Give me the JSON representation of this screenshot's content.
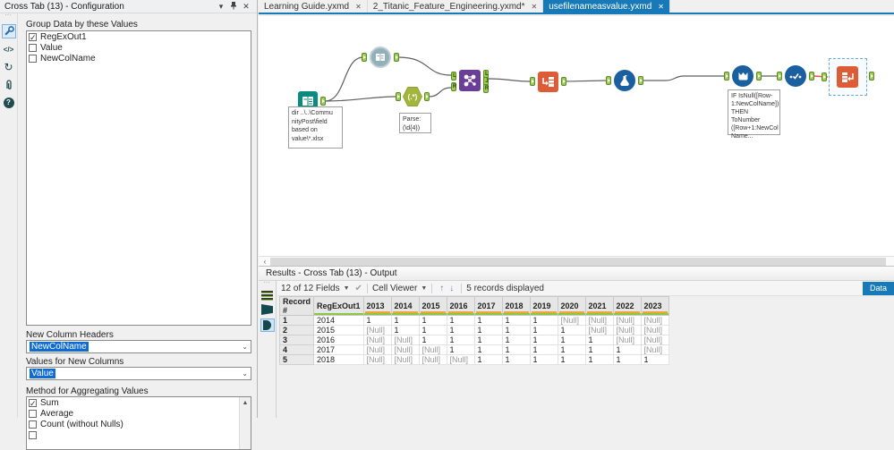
{
  "config_panel": {
    "title": "Cross Tab (13) - Configuration",
    "group_section_label": "Group Data by these Values",
    "group_items": [
      {
        "label": "RegExOut1",
        "checked": true
      },
      {
        "label": "Value",
        "checked": false
      },
      {
        "label": "NewColName",
        "checked": false
      }
    ],
    "new_column_headers": {
      "label": "New Column Headers",
      "value": "NewColName"
    },
    "values_for_new_columns": {
      "label": "Values for New Columns",
      "value": "Value"
    },
    "aggregation": {
      "label": "Method for Aggregating Values",
      "items": [
        {
          "label": "Sum",
          "checked": true
        },
        {
          "label": "Average",
          "checked": false
        },
        {
          "label": "Count (without Nulls)",
          "checked": false
        },
        {
          "label": "",
          "checked": false,
          "partial": true
        }
      ]
    }
  },
  "document_tabs": [
    {
      "label": "Learning Guide.yxmd",
      "active": false
    },
    {
      "label": "2_Titanic_Feature_Engineering.yxmd*",
      "active": false
    },
    {
      "label": "usefilenameasvalue.yxmd",
      "active": true
    }
  ],
  "canvas": {
    "tools": [
      {
        "name": "directory",
        "annotation": "dir ..\\..\\Commu\nnityPost\\field\nbased on\nvalue\\*.xlsx"
      },
      {
        "name": "dynamic-input"
      },
      {
        "name": "regex",
        "label": "(.*)",
        "annotation": "Parse:\n(\\d{4})"
      },
      {
        "name": "join",
        "ports_in": [
          "L",
          "R"
        ],
        "ports_out": [
          "L",
          "J",
          "R"
        ]
      },
      {
        "name": "transpose"
      },
      {
        "name": "formula"
      },
      {
        "name": "multi-row-formula",
        "annotation": "IF IsNull([Row-\n1:NewColName])\nTHEN ToNumber\n([Row+1:NewCol\nName..."
      },
      {
        "name": "select"
      },
      {
        "name": "cross-tab",
        "selected": true
      }
    ]
  },
  "results": {
    "title": "Results - Cross Tab (13) - Output",
    "toolbar": {
      "fields_summary": "12 of 12 Fields",
      "cell_viewer": "Cell Viewer",
      "records_summary": "5 records displayed",
      "data_button": "Data"
    },
    "table": {
      "columns": [
        "Record #",
        "RegExOut1",
        "2013",
        "2014",
        "2015",
        "2016",
        "2017",
        "2018",
        "2019",
        "2020",
        "2021",
        "2022",
        "2023"
      ],
      "rows": [
        [
          "1",
          "2014",
          "1",
          "1",
          "1",
          "1",
          "1",
          "1",
          "1",
          "[Null]",
          "[Null]",
          "[Null]",
          "[Null]"
        ],
        [
          "2",
          "2015",
          "[Null]",
          "1",
          "1",
          "1",
          "1",
          "1",
          "1",
          "1",
          "[Null]",
          "[Null]",
          "[Null]"
        ],
        [
          "3",
          "2016",
          "[Null]",
          "[Null]",
          "1",
          "1",
          "1",
          "1",
          "1",
          "1",
          "1",
          "[Null]",
          "[Null]"
        ],
        [
          "4",
          "2017",
          "[Null]",
          "[Null]",
          "[Null]",
          "1",
          "1",
          "1",
          "1",
          "1",
          "1",
          "1",
          "[Null]"
        ],
        [
          "5",
          "2018",
          "[Null]",
          "[Null]",
          "[Null]",
          "[Null]",
          "1",
          "1",
          "1",
          "1",
          "1",
          "1",
          "1"
        ]
      ]
    }
  },
  "colors": {
    "active_tab": "#1779b8",
    "anchor_green": "#8cc63e",
    "join_purple": "#6a3d97",
    "tool_teal": "#0b8a7e",
    "tool_orange": "#de5c35",
    "tool_blue": "#1a5fa0",
    "regex_olive": "#a3b53c",
    "error_wire": "#e25544",
    "quality_orange": "#f2a33c",
    "quality_green": "#8dc63f"
  }
}
